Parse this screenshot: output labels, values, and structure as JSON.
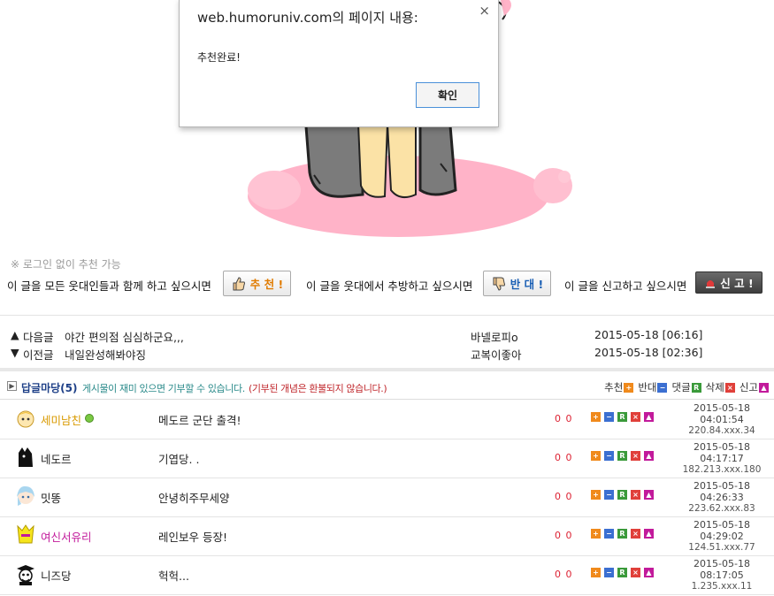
{
  "dialog": {
    "title": "web.humoruniv.com의 페이지 내용:",
    "close_glyph": "×",
    "message": "추천완료!",
    "ok_label": "확인"
  },
  "recommend": {
    "note": "※ 로그인 없이 추천 가능",
    "recommend_text": "이 글을 모든 웃대인들과 함께 하고 싶으시면",
    "recommend_label": "추 천 !",
    "oppose_text": "이 글을 웃대에서 추방하고 싶으시면",
    "oppose_label": "반 대 !",
    "report_text": "이 글을 신고하고 싶으시면",
    "report_label": "신 고 !"
  },
  "nav": {
    "next": {
      "arrow": "▲",
      "label": "다음글",
      "title": "야간 편의점 심심하군요,,,",
      "author": "바넬로피o",
      "date": "2015-05-18 [06:16]"
    },
    "prev": {
      "arrow": "▼",
      "label": "이전글",
      "title": "내일완성해봐야징",
      "author": "교복이좋아",
      "date": "2015-05-18 [02:36]"
    }
  },
  "comments_header": {
    "box_glyph": "▶",
    "title": "답글마당(5)",
    "note1": "게시물이 재미 있으면 기부할 수 있습니다.",
    "note2": "(기부된 개념은 환불되지 않습니다.)",
    "legend": [
      {
        "label": "추천",
        "glyph": "+",
        "kind": "plus"
      },
      {
        "label": "반대",
        "glyph": "−",
        "kind": "minus"
      },
      {
        "label": "댓글",
        "glyph": "R",
        "kind": "r"
      },
      {
        "label": "삭제",
        "glyph": "×",
        "kind": "x"
      },
      {
        "label": "신고",
        "glyph": "▲",
        "kind": "siren"
      }
    ]
  },
  "comments": [
    {
      "name": "세미남친",
      "name_color": "#d99a00",
      "online": true,
      "text": "메도르 군단 출격!",
      "up": "0",
      "down": "0",
      "date": "2015-05-18",
      "time": "04:01:54",
      "ip": "220.84.xxx.34",
      "avatar": "blonde"
    },
    {
      "name": "네도르",
      "name_color": "#222222",
      "online": false,
      "text": "기엽당. .",
      "up": "0",
      "down": "0",
      "date": "2015-05-18",
      "time": "04:17:17",
      "ip": "182.213.xxx.180",
      "avatar": "black-cat"
    },
    {
      "name": "밋똥",
      "name_color": "#222222",
      "online": false,
      "text": "안녕히주무세양",
      "up": "0",
      "down": "0",
      "date": "2015-05-18",
      "time": "04:26:33",
      "ip": "223.62.xxx.83",
      "avatar": "blue-hair"
    },
    {
      "name": "여신서유리",
      "name_color": "#c21a9b",
      "online": false,
      "text": "레인보우 등장!",
      "up": "0",
      "down": "0",
      "date": "2015-05-18",
      "time": "04:29:02",
      "ip": "124.51.xxx.77",
      "avatar": "yellow-figure"
    },
    {
      "name": "니즈당",
      "name_color": "#222222",
      "online": false,
      "text": "헉헉...",
      "up": "0",
      "down": "0",
      "date": "2015-05-18",
      "time": "08:17:05",
      "ip": "1.235.xxx.11",
      "avatar": "graduate"
    }
  ]
}
